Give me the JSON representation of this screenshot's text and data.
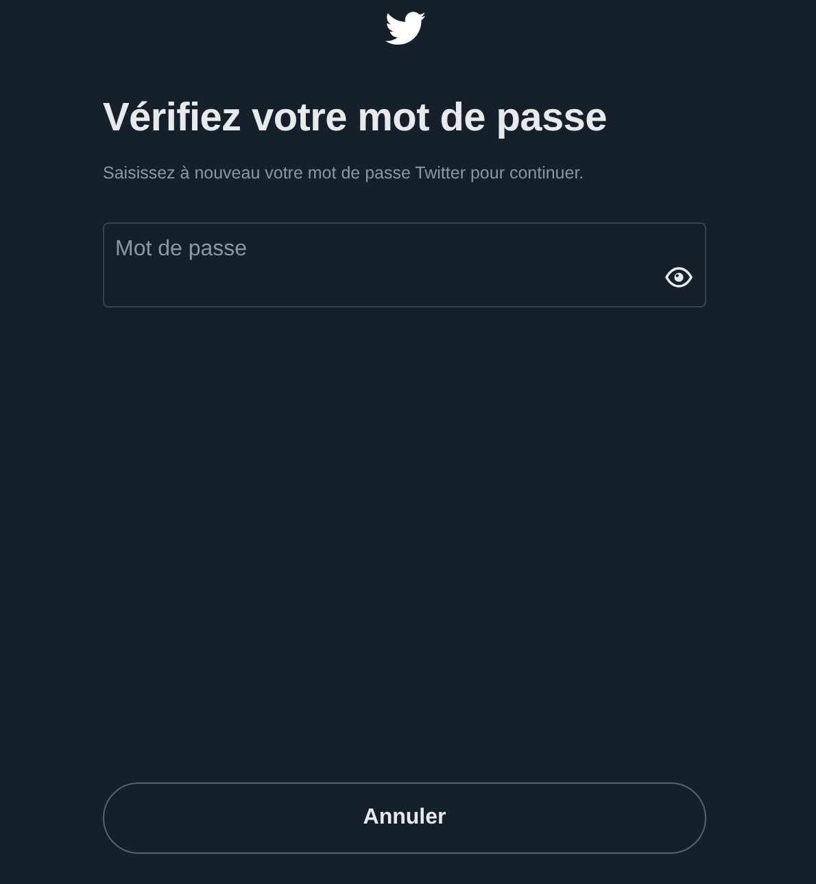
{
  "dialog": {
    "title": "Vérifiez votre mot de passe",
    "subtitle": "Saisissez à nouveau votre mot de passe Twitter pour continuer.",
    "password_field": {
      "placeholder": "Mot de passe"
    },
    "buttons": [
      {
        "label": "Annuler",
        "kind": "outline"
      }
    ]
  }
}
